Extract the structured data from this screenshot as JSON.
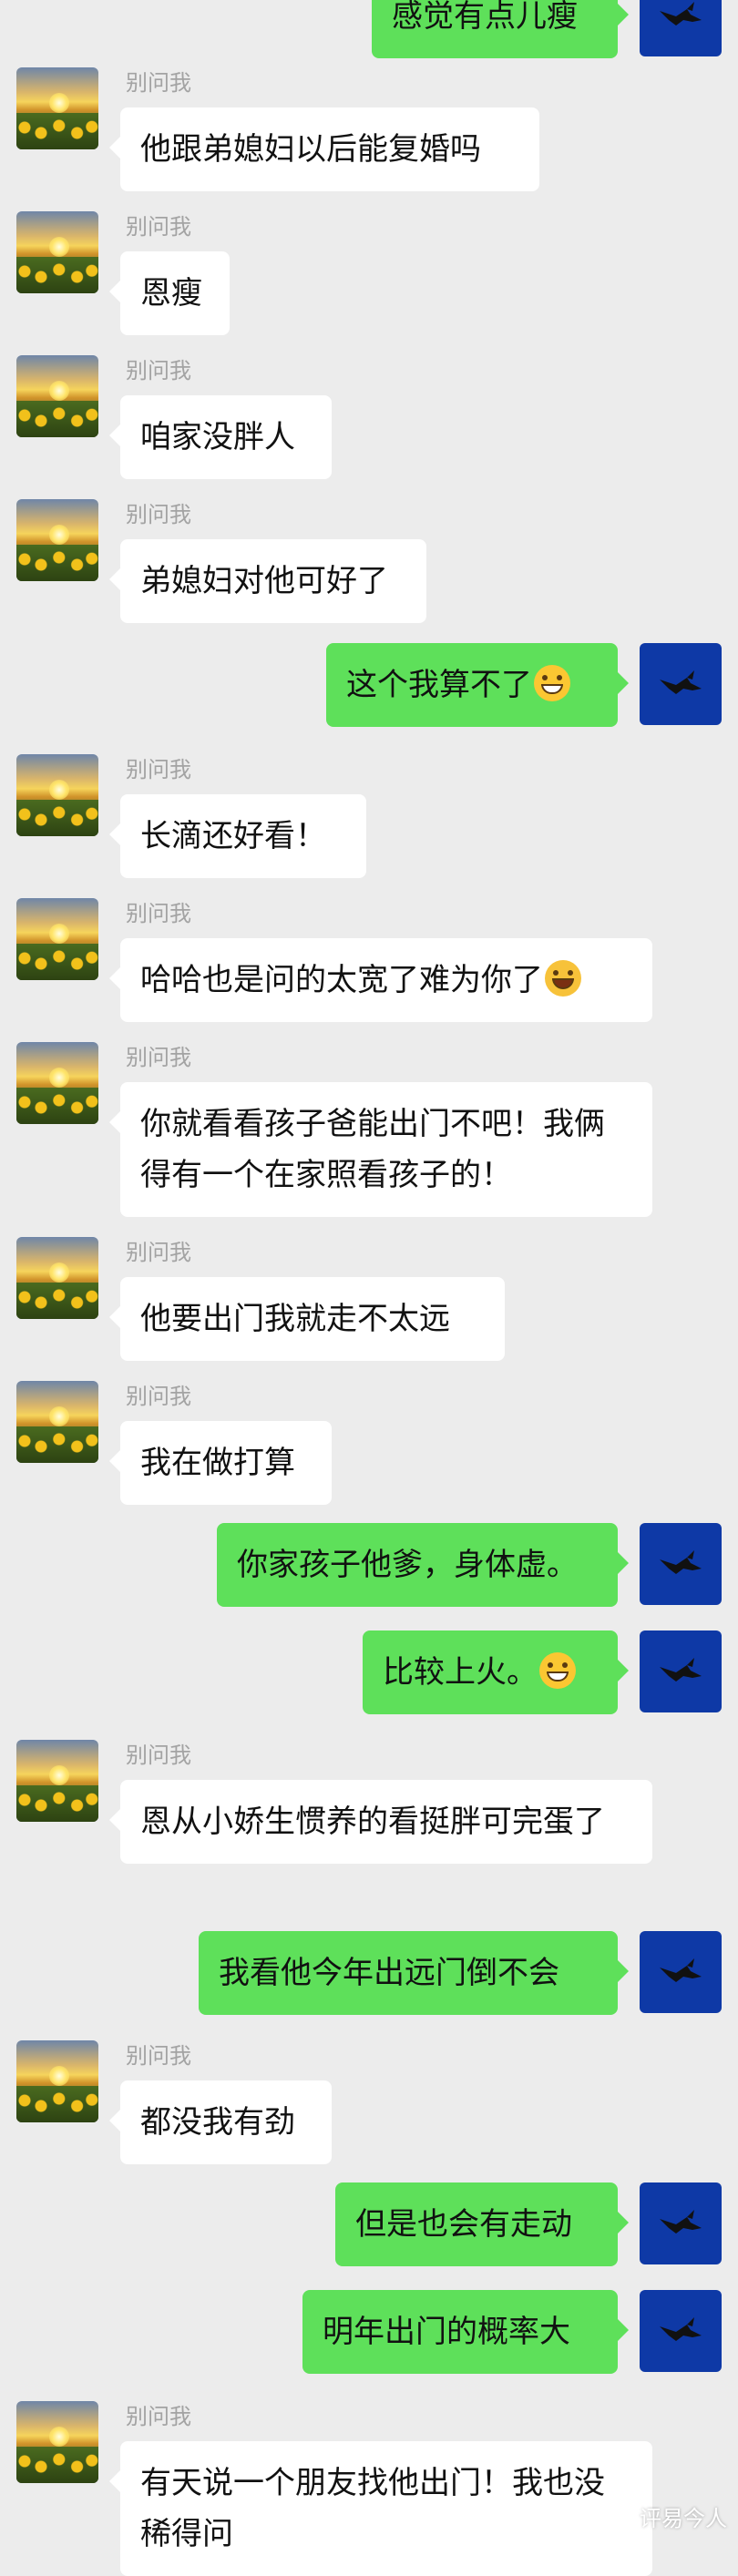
{
  "sender_name": "别问我",
  "watermark": "评易今人",
  "colors": {
    "background": "#ececec",
    "bubble_self": "#5ee05a",
    "bubble_other": "#ffffff",
    "avatar_self": "#0e39a6"
  },
  "messages": [
    {
      "side": "right",
      "text": "感觉有点儿瘦"
    },
    {
      "side": "left",
      "text": "他跟弟媳妇以后能复婚吗"
    },
    {
      "side": "left",
      "text": "恩瘦"
    },
    {
      "side": "left",
      "text": "咱家没胖人"
    },
    {
      "side": "left",
      "text": "弟媳妇对他可好了"
    },
    {
      "side": "right",
      "text": "这个我算不了",
      "emoji": "grin-emoji"
    },
    {
      "side": "left",
      "text": "长滴还好看！"
    },
    {
      "side": "left",
      "text": "哈哈也是问的太宽了难为你了",
      "emoji": "laugh-cry-emoji"
    },
    {
      "side": "left",
      "text": "你就看看孩子爸能出门不吧！我俩得有一个在家照看孩子的！"
    },
    {
      "side": "left",
      "text": "他要出门我就走不太远"
    },
    {
      "side": "left",
      "text": "我在做打算"
    },
    {
      "side": "right",
      "text": "你家孩子他爹，身体虚。"
    },
    {
      "side": "right",
      "text": "比较上火。",
      "emoji": "grin-emoji"
    },
    {
      "side": "left",
      "text": "恩从小娇生惯养的看挺胖可完蛋了"
    },
    {
      "side": "right",
      "text": "我看他今年出远门倒不会"
    },
    {
      "side": "left",
      "text": "都没我有劲"
    },
    {
      "side": "right",
      "text": "但是也会有走动"
    },
    {
      "side": "right",
      "text": "明年出门的概率大"
    },
    {
      "side": "left",
      "text": "有天说一个朋友找他出门！我也没稀得问"
    }
  ]
}
